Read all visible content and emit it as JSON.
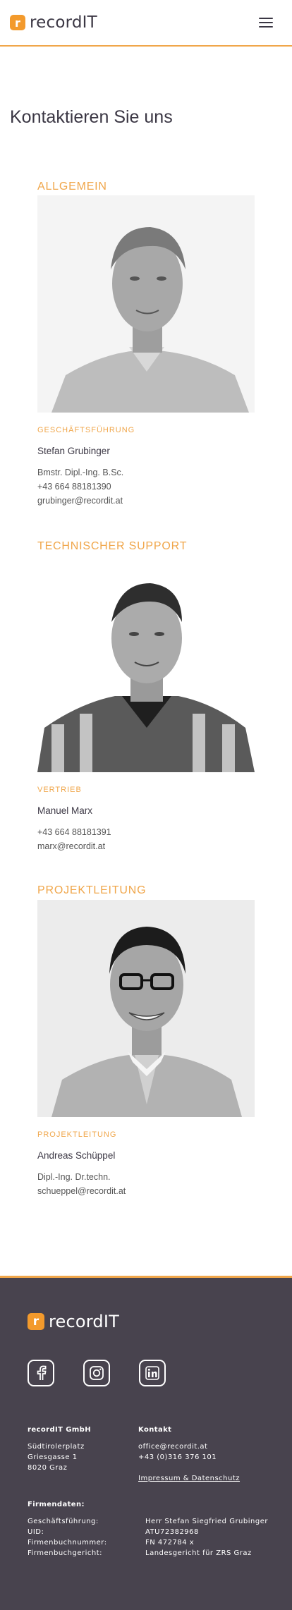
{
  "header": {
    "logo_mark": "r",
    "logo_text": "recordIT",
    "menu_icon": "hamburger-menu-icon"
  },
  "page": {
    "title": "Kontaktieren Sie uns"
  },
  "sections": [
    {
      "title": "ALLGEMEIN",
      "role": "GESCHÄFTSFÜHRUNG",
      "name": "Stefan Grubinger",
      "details": [
        "Bmstr. Dipl.-Ing. B.Sc.",
        "+43 664 88181390",
        "grubinger@recordit.at"
      ]
    },
    {
      "title": "TECHNISCHER SUPPORT",
      "role": "VERTRIEB",
      "name": "Manuel Marx",
      "details": [
        "+43 664 88181391",
        "marx@recordit.at"
      ]
    },
    {
      "title": "PROJEKTLEITUNG",
      "role": "PROJEKTLEITUNG",
      "name": "Andreas Schüppel",
      "details": [
        "Dipl.-Ing. Dr.techn.",
        "schueppel@recordit.at"
      ]
    }
  ],
  "footer": {
    "logo_mark": "r",
    "logo_text": "recordIT",
    "social_icons": [
      "facebook-icon",
      "instagram-icon",
      "linkedin-icon"
    ],
    "company": {
      "heading": "recordIT GmbH",
      "lines": [
        "Südtirolerplatz",
        "Griesgasse 1",
        "8020 Graz"
      ]
    },
    "contact": {
      "heading": "Kontakt",
      "lines": [
        "office@recordit.at",
        "+43 (0)316 376 101"
      ],
      "link": "Impressum & Datenschutz"
    },
    "firmendaten": {
      "heading": "Firmendaten:",
      "labels": [
        "Geschäftsführung:",
        "UID:",
        "Firmenbuchnummer:",
        "Firmenbuchgericht:"
      ],
      "values": [
        "Herr Stefan Siegfried Grubinger",
        "ATU72382968",
        "FN 472784 x",
        "Landesgericht für ZRS Graz"
      ]
    }
  },
  "colors": {
    "accent": "#f0a64a",
    "brand_mark": "#f39a2c",
    "footer_bg": "#48434e",
    "text_dark": "#3b3744"
  }
}
